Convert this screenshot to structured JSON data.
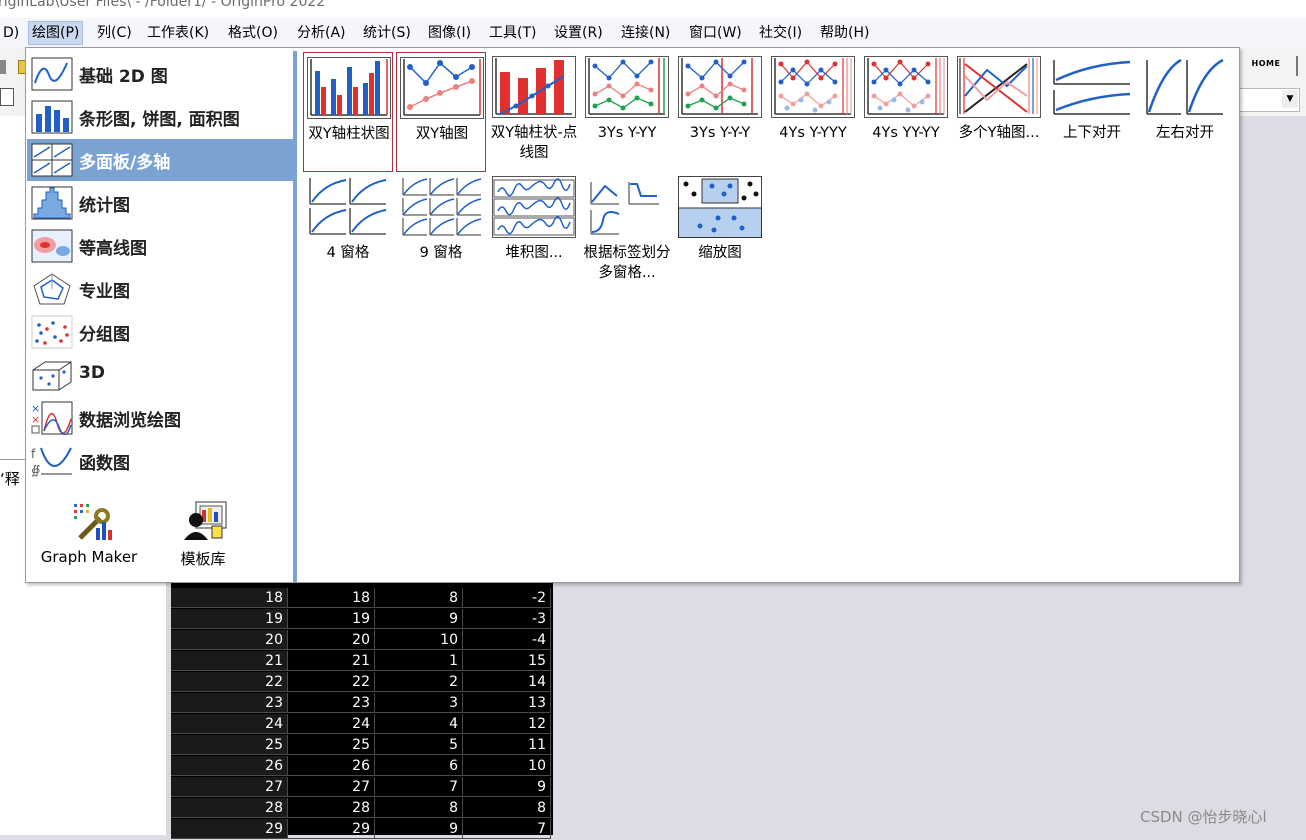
{
  "title_bar": {
    "text": "riginLab\\User Files\\ - /Folder1/ - OriginPro 2022"
  },
  "menu": [
    {
      "label": "D)"
    },
    {
      "label": "绘图(P)",
      "active": true
    },
    {
      "label": "列(C)"
    },
    {
      "label": "工作表(K)"
    },
    {
      "label": "格式(O)"
    },
    {
      "label": "分析(A)"
    },
    {
      "label": "统计(S)"
    },
    {
      "label": "图像(I)"
    },
    {
      "label": "工具(T)"
    },
    {
      "label": "设置(R)"
    },
    {
      "label": "连接(N)"
    },
    {
      "label": "窗口(W)"
    },
    {
      "label": "社交(I)"
    },
    {
      "label": "帮助(H)"
    }
  ],
  "toolbar": {
    "home_label": "HOME"
  },
  "left_panel": {
    "label": "‘释"
  },
  "plot_menu": {
    "categories": [
      {
        "label": "基础 2D 图",
        "icon": "line-plot-icon"
      },
      {
        "label": "条形图, 饼图, 面积图",
        "icon": "bar-chart-icon"
      },
      {
        "label": "多面板/多轴",
        "icon": "multi-panel-icon",
        "selected": true
      },
      {
        "label": "统计图",
        "icon": "histogram-icon"
      },
      {
        "label": "等高线图",
        "icon": "contour-icon"
      },
      {
        "label": "专业图",
        "icon": "radar-icon"
      },
      {
        "label": "分组图",
        "icon": "grouped-scatter-icon"
      },
      {
        "label": "3D",
        "icon": "3d-scatter-icon"
      },
      {
        "label": "数据浏览绘图",
        "icon": "data-explorer-icon"
      },
      {
        "label": "函数图",
        "icon": "function-plot-icon"
      }
    ],
    "tools": [
      {
        "label": "Graph Maker",
        "icon": "graph-maker-icon"
      },
      {
        "label": "模板库",
        "icon": "template-library-icon"
      }
    ],
    "templates": [
      {
        "label": "双Y轴柱状图",
        "icon": "double-y-column-icon",
        "selected": true
      },
      {
        "label": "双Y轴图",
        "icon": "double-y-line-icon",
        "selected": true
      },
      {
        "label": "双Y轴柱状-点线图",
        "icon": "double-y-column-line-icon"
      },
      {
        "label": "3Ys Y-YY",
        "icon": "3ys-y-yy-icon"
      },
      {
        "label": "3Ys Y-Y-Y",
        "icon": "3ys-y-y-y-icon"
      },
      {
        "label": "4Ys Y-YYY",
        "icon": "4ys-y-yyy-icon"
      },
      {
        "label": "4Ys YY-YY",
        "icon": "4ys-yy-yy-icon"
      },
      {
        "label": "多个Y轴图...",
        "icon": "multi-y-axis-icon"
      },
      {
        "label": "上下对开",
        "icon": "stack-vertical-icon"
      },
      {
        "label": "左右对开",
        "icon": "stack-horizontal-icon"
      },
      {
        "label": "4 窗格",
        "icon": "four-panel-icon"
      },
      {
        "label": "9 窗格",
        "icon": "nine-panel-icon"
      },
      {
        "label": "堆积图...",
        "icon": "stack-plot-icon"
      },
      {
        "label": "根据标签划分多窗格...",
        "icon": "split-by-label-icon"
      },
      {
        "label": "缩放图",
        "icon": "zoom-plot-icon"
      }
    ]
  },
  "worksheet": {
    "rows": [
      [
        "18",
        "18",
        "8",
        "-2"
      ],
      [
        "19",
        "19",
        "9",
        "-3"
      ],
      [
        "20",
        "20",
        "10",
        "-4"
      ],
      [
        "21",
        "21",
        "1",
        "15"
      ],
      [
        "22",
        "22",
        "2",
        "14"
      ],
      [
        "23",
        "23",
        "3",
        "13"
      ],
      [
        "24",
        "24",
        "4",
        "12"
      ],
      [
        "25",
        "25",
        "5",
        "11"
      ],
      [
        "26",
        "26",
        "6",
        "10"
      ],
      [
        "27",
        "27",
        "7",
        "9"
      ],
      [
        "28",
        "28",
        "8",
        "8"
      ],
      [
        "29",
        "29",
        "9",
        "7"
      ]
    ]
  },
  "watermark": "CSDN @怡步晓心l"
}
